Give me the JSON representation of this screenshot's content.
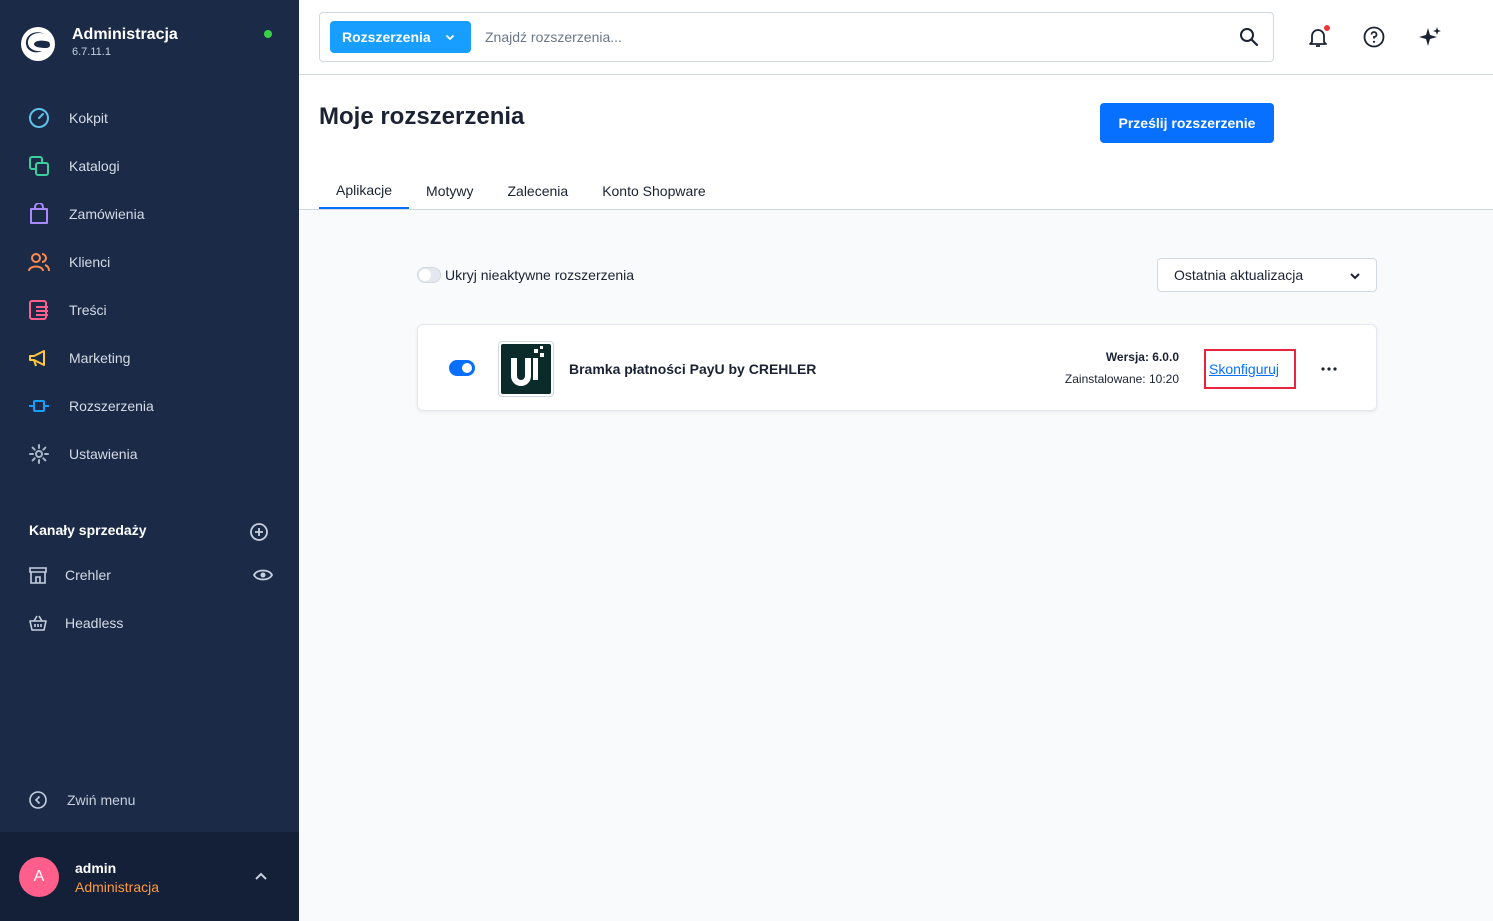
{
  "brand": {
    "title": "Administracja",
    "version": "6.7.11.1"
  },
  "sidebar": {
    "items": [
      {
        "label": "Kokpit",
        "icon": "dashboard-icon",
        "color": "#5fc3e8"
      },
      {
        "label": "Katalogi",
        "icon": "catalog-icon",
        "color": "#3ccf9e"
      },
      {
        "label": "Zamówienia",
        "icon": "orders-icon",
        "color": "#a88bfa"
      },
      {
        "label": "Klienci",
        "icon": "customers-icon",
        "color": "#ff8a50"
      },
      {
        "label": "Treści",
        "icon": "content-icon",
        "color": "#ff5f8a"
      },
      {
        "label": "Marketing",
        "icon": "marketing-icon",
        "color": "#ffc83d"
      },
      {
        "label": "Rozszerzenia",
        "icon": "extensions-icon",
        "color": "#189eff"
      },
      {
        "label": "Ustawienia",
        "icon": "settings-icon",
        "color": "#a9b4c5"
      }
    ],
    "sales_channels_title": "Kanały sprzedaży",
    "channels": [
      {
        "label": "Crehler",
        "icon": "storefront-icon"
      },
      {
        "label": "Headless",
        "icon": "basket-icon"
      }
    ],
    "collapse_label": "Zwiń menu"
  },
  "user": {
    "initial": "A",
    "name": "admin",
    "role": "Administracja"
  },
  "search": {
    "type_label": "Rozszerzenia",
    "placeholder": "Znajdź rozszerzenia..."
  },
  "header": {
    "title": "Moje rozszerzenia",
    "upload_label": "Prześlij rozszerzenie",
    "tabs": [
      {
        "label": "Aplikacje"
      },
      {
        "label": "Motywy"
      },
      {
        "label": "Zalecenia"
      },
      {
        "label": "Konto Shopware"
      }
    ]
  },
  "filters": {
    "hide_inactive_label": "Ukryj nieaktywne rozszerzenia",
    "sort_value": "Ostatnia aktualizacja"
  },
  "extension": {
    "name": "Bramka płatności PayU by CREHLER",
    "version_label": "Wersja:",
    "version_value": "6.0.0",
    "installed_label": "Zainstalowane:",
    "installed_value": "10:20",
    "configure_label": "Skonfiguruj"
  },
  "colors": {
    "sidebar_bg": "#1b2a47",
    "primary": "#0870ff",
    "search_type_bg": "#189eff",
    "highlight_border": "#e8243f",
    "status_online": "#37d046"
  }
}
